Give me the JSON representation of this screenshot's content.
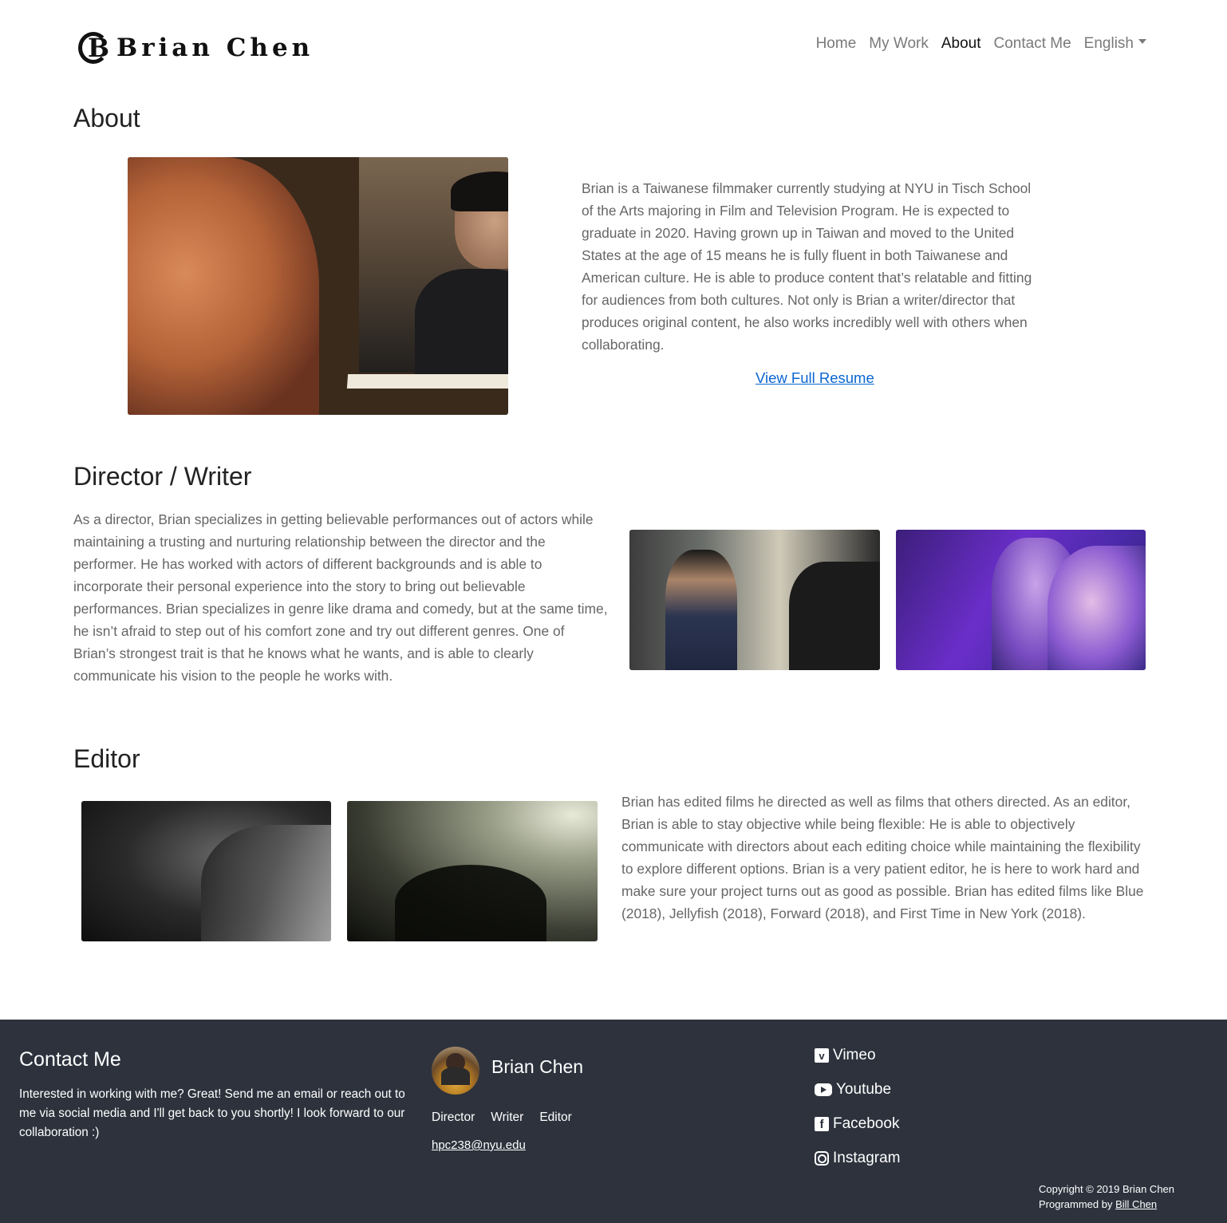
{
  "brand": {
    "name": "Brian Chen",
    "monogram_c": "C",
    "monogram_b": "B"
  },
  "nav": {
    "items": [
      {
        "label": "Home"
      },
      {
        "label": "My Work"
      },
      {
        "label": "About"
      },
      {
        "label": "Contact Me"
      },
      {
        "label": "English"
      }
    ],
    "active": "About"
  },
  "about": {
    "title": "About",
    "text": "Brian is a Taiwanese filmmaker currently studying at NYU in Tisch School of the Arts majoring in Film and Television Program. He is expected to graduate in 2020. Having grown up in Taiwan and moved to the United States at the age of 15 means he is fully fluent in both Taiwanese and American culture. He is able to produce content that’s relatable and fitting for audiences from both cultures. Not only is Brian a writer/director that produces original content, he also works incredibly well with others when collaborating.",
    "resume_link": "View Full Resume"
  },
  "director": {
    "title": "Director / Writer",
    "text": "As a director, Brian specializes in getting believable performances out of actors while maintaining a trusting and nurturing relationship between the director and the performer. He has worked with actors of different backgrounds and is able to incorporate their personal experience into the story to bring out believable performances. Brian specializes in genre like drama and comedy, but at the same time, he isn’t afraid to step out of his comfort zone and try out different genres. One of Brian’s strongest trait is that he knows what he wants, and is able to clearly communicate his vision to the people he works with."
  },
  "editor": {
    "title": "Editor",
    "text": "Brian has edited films he directed as well as films that others directed. As an editor, Brian is able to stay objective while being flexible: He is able to objectively communicate with directors about each editing choice while maintaining the flexibility to explore different options. Brian is a very patient editor, he is here to work hard and make sure your project turns out as good as possible. Brian has edited films like Blue (2018), Jellyfish (2018), Forward (2018), and First Time in New York (2018)."
  },
  "footer": {
    "contact_title": "Contact Me",
    "contact_text": "Interested in working with me? Great! Send me an email or reach out to me via social media and I'll get back to you shortly! I look forward to our collaboration :)",
    "name": "Brian Chen",
    "roles": [
      "Director",
      "Writer",
      "Editor"
    ],
    "email": "hpc238@nyu.edu",
    "social": [
      {
        "label": "Vimeo",
        "icon": "vimeo-icon"
      },
      {
        "label": "Youtube",
        "icon": "youtube-icon"
      },
      {
        "label": "Facebook",
        "icon": "facebook-icon"
      },
      {
        "label": "Instagram",
        "icon": "instagram-icon"
      }
    ],
    "copyright": "Copyright © 2019  Brian Chen",
    "programmed_by_label": "Programmed by",
    "programmed_by_name": "Bill Chen"
  },
  "colors": {
    "footer_bg": "#2d323d",
    "link": "#0a66d0",
    "nav_active": "#111111",
    "nav_inactive": "#7a7a7a"
  }
}
